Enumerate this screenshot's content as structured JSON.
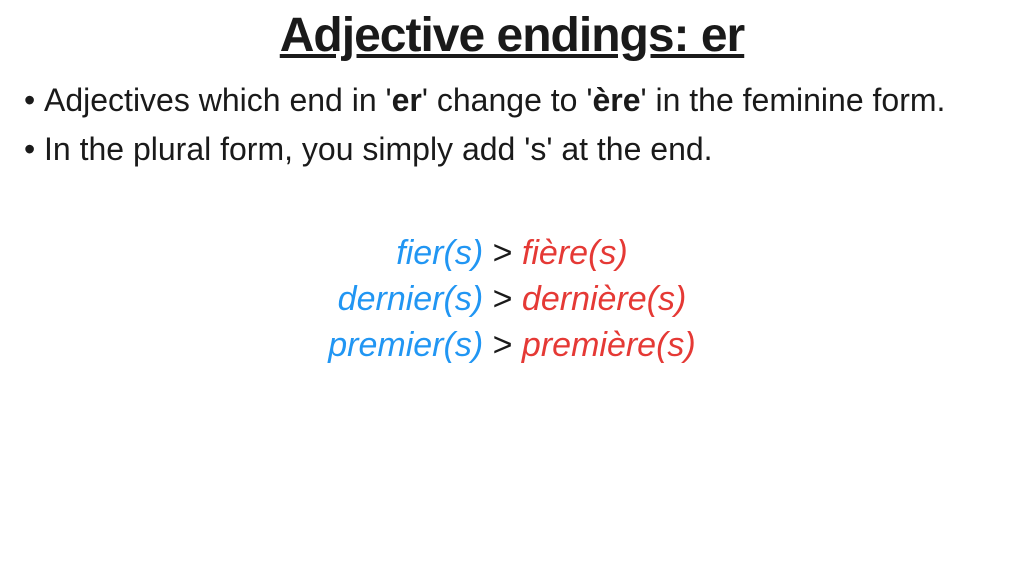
{
  "title": "Adjective endings: er",
  "bullets": {
    "b1_pre": "Adjectives which end in '",
    "b1_bold1": "er",
    "b1_mid": "' change to '",
    "b1_bold2": "ère",
    "b1_post": "' in the feminine form.",
    "b2": "In the plural form, you simply add 's' at the end."
  },
  "separator": ">",
  "examples": [
    {
      "masc": "fier(s)",
      "fem": "fière(s)"
    },
    {
      "masc": "dernier(s)",
      "fem": "dernière(s)"
    },
    {
      "masc": "premier(s)",
      "fem": "première(s)"
    }
  ]
}
